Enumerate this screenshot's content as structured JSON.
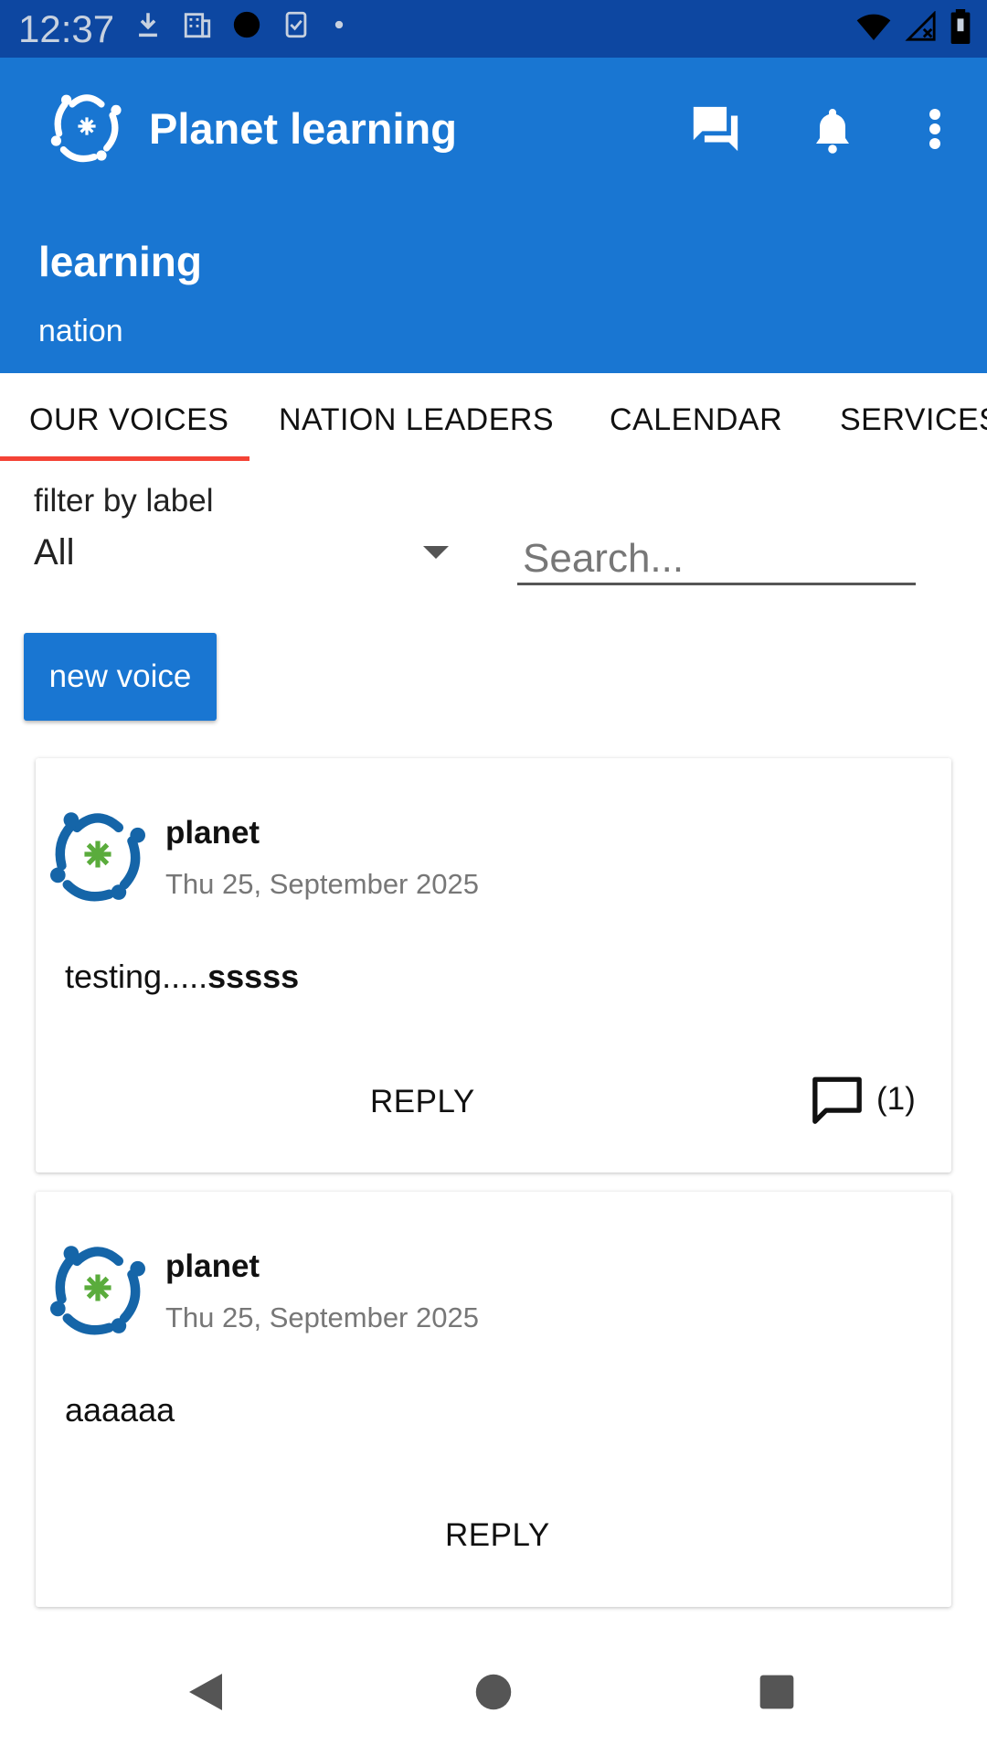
{
  "status_bar": {
    "time": "12:37",
    "left_icons": [
      "download-icon",
      "building-icon",
      "circle-icon",
      "clipboard-check-icon",
      "dot-icon"
    ],
    "right_icons": [
      "wifi-icon",
      "signal-icon",
      "battery-icon"
    ]
  },
  "app_bar": {
    "title": "Planet learning",
    "subtitle": "learning",
    "subtitle2": "nation",
    "actions": [
      "chat-icon",
      "bell-icon",
      "more-vert-icon"
    ],
    "color": "#1976d2"
  },
  "tabs": [
    {
      "label": "OUR VOICES",
      "selected": true
    },
    {
      "label": "NATION LEADERS",
      "selected": false
    },
    {
      "label": "CALENDAR",
      "selected": false
    },
    {
      "label": "SERVICES",
      "selected": false
    }
  ],
  "filter": {
    "label": "filter by label",
    "value": "All"
  },
  "search": {
    "placeholder": "Search..."
  },
  "new_voice_label": "new voice",
  "posts": [
    {
      "author": "planet",
      "date": "Thu 25, September 2025",
      "message_prefix": "testing.....",
      "message_bold": "sssss",
      "reply_label": "REPLY",
      "comment_count": "(1)"
    },
    {
      "author": "planet",
      "date": "Thu 25, September 2025",
      "message_prefix": "aaaaaa",
      "message_bold": "",
      "reply_label": "REPLY",
      "comment_count": ""
    }
  ],
  "nav": [
    "back-icon",
    "home-icon",
    "recents-icon"
  ]
}
